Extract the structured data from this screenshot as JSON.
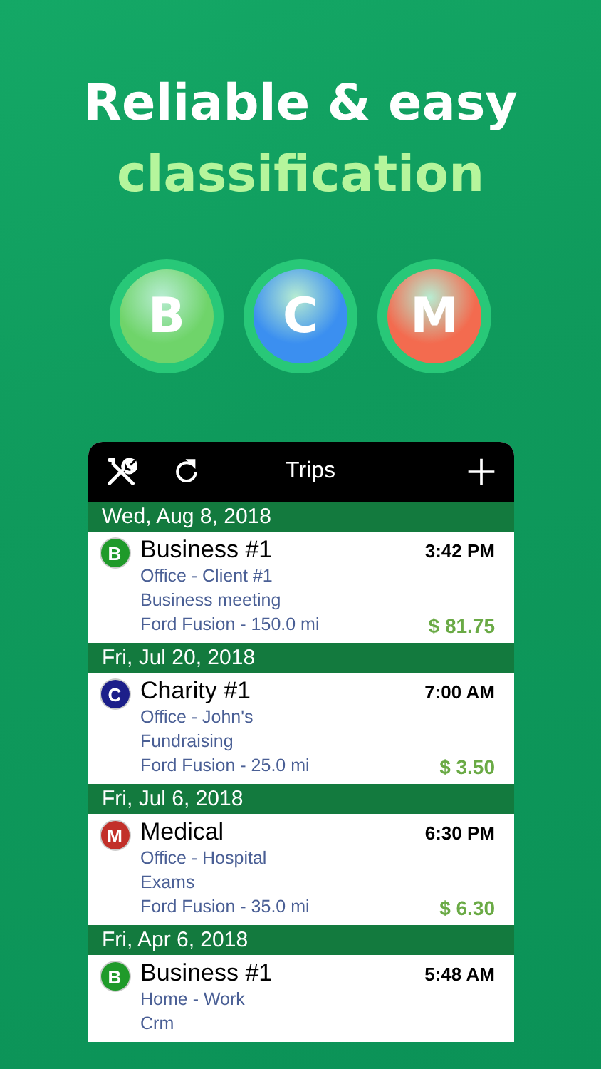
{
  "headline": {
    "line_1": "Reliable & easy",
    "line_2": "classification"
  },
  "categories": [
    {
      "letter": "B",
      "color": "#6fd46a"
    },
    {
      "letter": "C",
      "color": "#3b8ff0"
    },
    {
      "letter": "M",
      "color": "#f36b4f"
    }
  ],
  "app": {
    "title": "Trips",
    "groups": [
      {
        "date": "Wed, Aug 8, 2018",
        "trip": {
          "letter": "B",
          "color": "#1f9a2a",
          "name": "Business #1",
          "time": "3:42 PM",
          "lines": [
            "Office - Client #1",
            "Business meeting",
            "Ford Fusion - 150.0 mi"
          ],
          "amount": "$ 81.75"
        }
      },
      {
        "date": "Fri, Jul 20, 2018",
        "trip": {
          "letter": "C",
          "color": "#1c1f8a",
          "name": "Charity #1",
          "time": "7:00 AM",
          "lines": [
            "Office - John's",
            "Fundraising",
            "Ford Fusion - 25.0 mi"
          ],
          "amount": "$ 3.50"
        }
      },
      {
        "date": "Fri, Jul 6, 2018",
        "trip": {
          "letter": "M",
          "color": "#c2302a",
          "name": "Medical",
          "time": "6:30 PM",
          "lines": [
            "Office - Hospital",
            "Exams",
            "Ford Fusion - 35.0 mi"
          ],
          "amount": "$ 6.30"
        }
      },
      {
        "date": "Fri, Apr 6, 2018",
        "trip": {
          "letter": "B",
          "color": "#1f9a2a",
          "name": "Business #1",
          "time": "5:48 AM",
          "lines": [
            "Home - Work",
            "Crm"
          ]
        }
      }
    ]
  }
}
